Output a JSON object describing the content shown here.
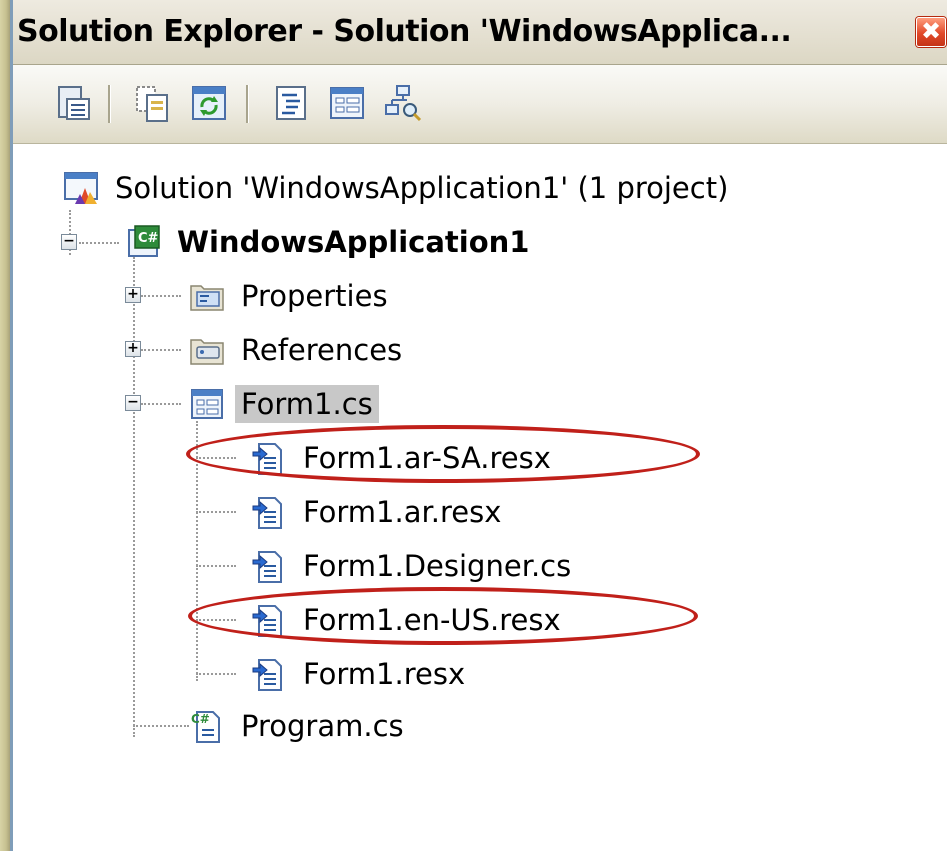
{
  "window": {
    "title": "Solution Explorer - Solution 'WindowsApplica...",
    "close_glyph": "✖"
  },
  "toolbar": {
    "buttons": [
      {
        "icon": "properties-icon"
      },
      {
        "icon": "show-all-files-icon"
      },
      {
        "icon": "refresh-icon"
      },
      {
        "icon": "view-code-icon"
      },
      {
        "icon": "view-designer-icon"
      },
      {
        "icon": "class-diagram-icon"
      }
    ]
  },
  "tree": {
    "solution": {
      "label": "Solution 'WindowsApplication1' (1 project)",
      "icon": "solution-icon"
    },
    "project": {
      "label": "WindowsApplication1",
      "icon": "csharp-project-icon",
      "expanded": true
    },
    "items": [
      {
        "label": "Properties",
        "icon": "properties-folder-icon",
        "expander": "+"
      },
      {
        "label": "References",
        "icon": "references-folder-icon",
        "expander": "+"
      },
      {
        "label": "Form1.cs",
        "icon": "form-icon",
        "expander": "−",
        "selected": true
      }
    ],
    "form_children": [
      {
        "label": "Form1.ar-SA.resx",
        "icon": "resx-file-icon",
        "highlighted": true
      },
      {
        "label": "Form1.ar.resx",
        "icon": "resx-file-icon",
        "highlighted": false
      },
      {
        "label": "Form1.Designer.cs",
        "icon": "resx-file-icon",
        "highlighted": false
      },
      {
        "label": "Form1.en-US.resx",
        "icon": "resx-file-icon",
        "highlighted": true
      },
      {
        "label": "Form1.resx",
        "icon": "resx-file-icon",
        "highlighted": false
      }
    ],
    "program": {
      "label": "Program.cs",
      "icon": "csharp-file-icon"
    },
    "project_expander": "−"
  },
  "colors": {
    "highlight_ring": "#c0201a",
    "selection": "#c8c8c8",
    "close_button": "#e1492a"
  }
}
